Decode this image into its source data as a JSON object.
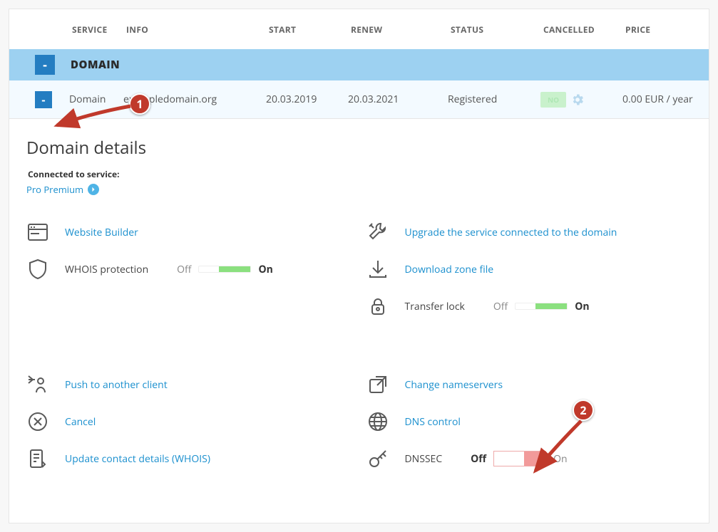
{
  "table": {
    "headers": {
      "service": "SERVICE",
      "info": "INFO",
      "start": "START",
      "renew": "RENEW",
      "status": "STATUS",
      "cancelled": "CANCELLED",
      "price": "PRICE"
    },
    "group": {
      "label": "DOMAIN",
      "collapse_glyph": "-"
    },
    "row": {
      "collapse_glyph": "-",
      "service": "Domain",
      "info": "exampledomain.org",
      "start": "20.03.2019",
      "renew": "20.03.2021",
      "status": "Registered",
      "cancelled_badge": "NO",
      "price": "0.00 EUR / year"
    }
  },
  "details": {
    "title": "Domain details",
    "connected_label": "Connected to service:",
    "connected_service": "Pro Premium",
    "left": {
      "website_builder": "Website Builder",
      "whois": "WHOIS protection",
      "push": "Push to another client",
      "cancel": "Cancel",
      "update_whois": "Update contact details (WHOIS)"
    },
    "right": {
      "upgrade": "Upgrade the service connected to the domain",
      "download_zone": "Download zone file",
      "transfer_lock": "Transfer lock",
      "change_ns": "Change nameservers",
      "dns_control": "DNS control",
      "dnssec": "DNSSEC"
    },
    "toggle": {
      "off": "Off",
      "on": "On"
    }
  },
  "annotations": {
    "one": "1",
    "two": "2"
  }
}
